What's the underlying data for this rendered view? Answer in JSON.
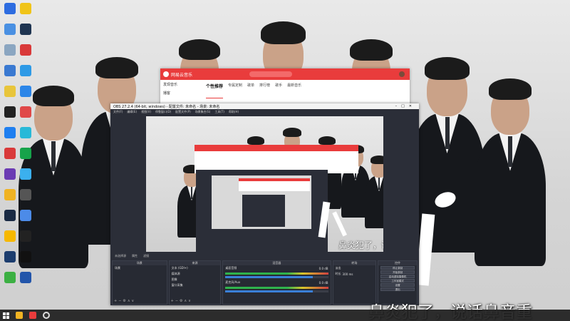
{
  "desktop": {
    "icons": [
      {
        "label": "",
        "color": "#2d6ce0"
      },
      {
        "label": "",
        "color": "#f0c419"
      },
      {
        "label": "",
        "color": "#4a90e2"
      },
      {
        "label": "",
        "color": "#1f3552"
      },
      {
        "label": "",
        "color": "#8ba6c1"
      },
      {
        "label": "",
        "color": "#d93a3a"
      },
      {
        "label": "",
        "color": "#3a79d1"
      },
      {
        "label": "",
        "color": "#2e9ae6"
      },
      {
        "label": "",
        "color": "#e8c53b"
      },
      {
        "label": "",
        "color": "#2c86e8"
      },
      {
        "label": "",
        "color": "#222"
      },
      {
        "label": "",
        "color": "#e04848"
      },
      {
        "label": "",
        "color": "#1e7ff0"
      },
      {
        "label": "",
        "color": "#28b9d8"
      },
      {
        "label": "",
        "color": "#d93a3a"
      },
      {
        "label": "",
        "color": "#16a34a"
      },
      {
        "label": "",
        "color": "#6b3bb3"
      },
      {
        "label": "",
        "color": "#3bb0ee"
      },
      {
        "label": "",
        "color": "#f0b323"
      },
      {
        "label": "",
        "color": "#555"
      },
      {
        "label": "",
        "color": "#1a2a44"
      },
      {
        "label": "",
        "color": "#4c8be8"
      },
      {
        "label": "",
        "color": "#f6b800"
      },
      {
        "label": "",
        "color": "#222"
      },
      {
        "label": "",
        "color": "#1c3d6e"
      },
      {
        "label": "",
        "color": "#111"
      },
      {
        "label": "",
        "color": "#3cb043"
      },
      {
        "label": "",
        "color": "#2255aa"
      }
    ]
  },
  "music": {
    "app_name": "网易云音乐",
    "search_placeholder": "",
    "user": "",
    "sidebar": [
      "发现音乐",
      "播客"
    ],
    "tabs": [
      "个性推荐",
      "专属定制",
      "歌单",
      "排行榜",
      "歌手",
      "最新音乐"
    ]
  },
  "obs": {
    "title": "OBS 27.2.4 (64-bit, windows) - 配置文件: 未命名 - 场景: 未命名",
    "menu": [
      "文件(F)",
      "编辑(E)",
      "视图(V)",
      "停靠窗口(D)",
      "配置文件(P)",
      "场景集合(S)",
      "工具(T)",
      "帮助(H)"
    ],
    "source_bar": {
      "no_source": "未选择源",
      "properties": "属性",
      "filters": "滤镜"
    },
    "docks": {
      "scenes": {
        "header": "场景",
        "items": [
          "场景"
        ]
      },
      "sources": {
        "header": "来源",
        "items": [
          "文本 (GDI+)",
          "媒体源",
          "图像",
          "窗口采集"
        ]
      },
      "mixer": {
        "header": "混音器",
        "tracks": [
          {
            "name": "桌面音频",
            "level": "0.0 dB"
          },
          {
            "name": "麦克风/Aux",
            "level": "0.0 dB"
          }
        ]
      },
      "transitions": {
        "header": "转场",
        "type": "淡出",
        "duration_label": "时长",
        "duration": "300 ms"
      },
      "controls": {
        "header": "控件",
        "buttons": [
          "停止录制",
          "开始录制",
          "启动虚拟摄像机",
          "工作室模式",
          "设置",
          "退出"
        ]
      }
    }
  },
  "subtitle": "鼻炎犯了，说话鼻音重",
  "preview_subtitle": "鼻炎犯了，说话鼻音重"
}
